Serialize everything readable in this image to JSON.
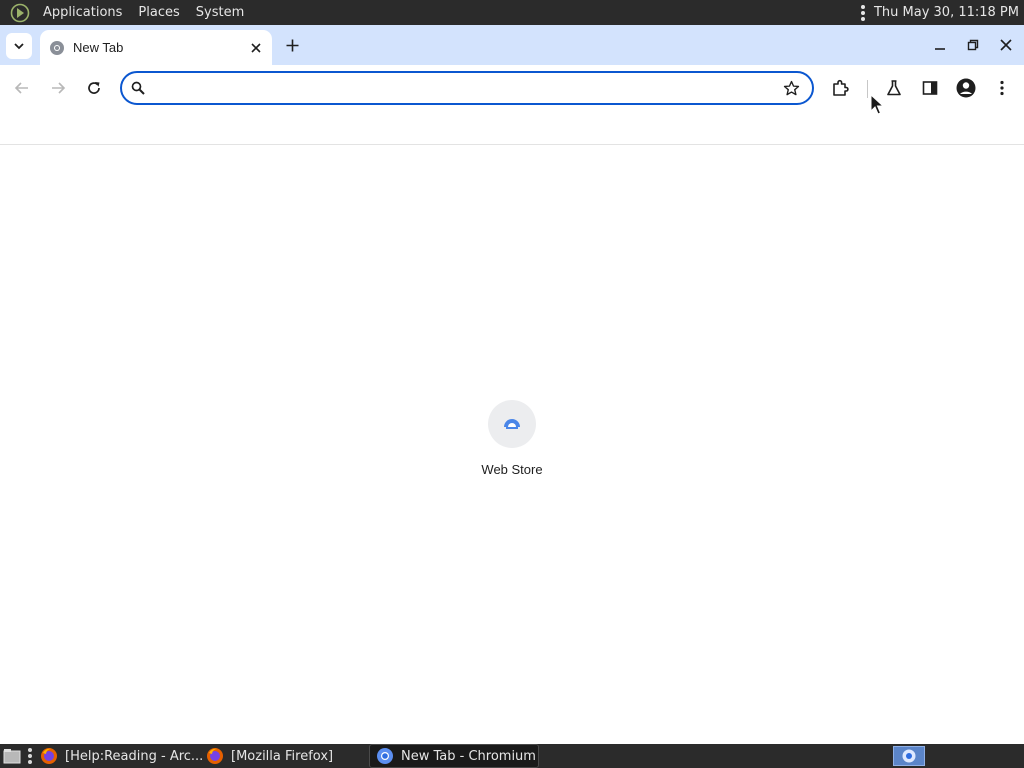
{
  "system_panel": {
    "menus": [
      "Applications",
      "Places",
      "System"
    ],
    "clock": "Thu May 30, 11:18 PM"
  },
  "browser": {
    "tab": {
      "title": "New Tab"
    },
    "omnibox": {
      "value": "",
      "placeholder": ""
    }
  },
  "new_tab_page": {
    "shortcuts": [
      {
        "label": "Web Store"
      }
    ]
  },
  "taskbar": {
    "tasks": [
      {
        "label": "[Help:Reading - Arc...",
        "icon": "firefox-icon",
        "active": false
      },
      {
        "label": "[Mozilla Firefox]",
        "icon": "firefox-icon",
        "active": false
      },
      {
        "label": "New Tab - Chromium",
        "icon": "chromium-icon",
        "active": true
      }
    ]
  },
  "colors": {
    "tabstrip": "#d3e3fd",
    "omnibox_focus": "#0b57d0",
    "panel": "#2b2b2b"
  }
}
